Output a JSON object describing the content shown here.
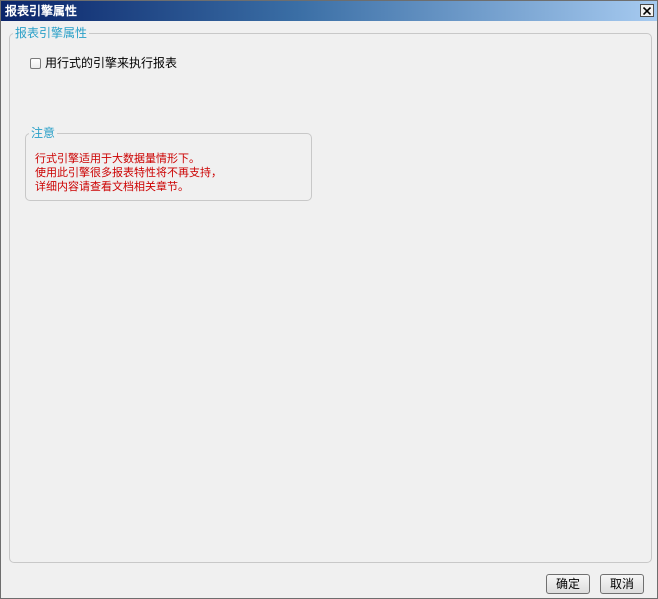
{
  "window": {
    "title": "报表引擎属性"
  },
  "engine_group": {
    "legend": "报表引擎属性",
    "checkbox_label": "用行式的引擎来执行报表",
    "checkbox_checked": false
  },
  "note_group": {
    "legend": "注意",
    "lines": [
      "行式引擎适用于大数据量情形下。",
      "使用此引擎很多报表特性将不再支持，",
      "详细内容请查看文档相关章节。"
    ],
    "text_color": "#cc0000"
  },
  "buttons": {
    "ok_label": "确定",
    "cancel_label": "取消"
  },
  "icons": {
    "close": "close-icon"
  }
}
